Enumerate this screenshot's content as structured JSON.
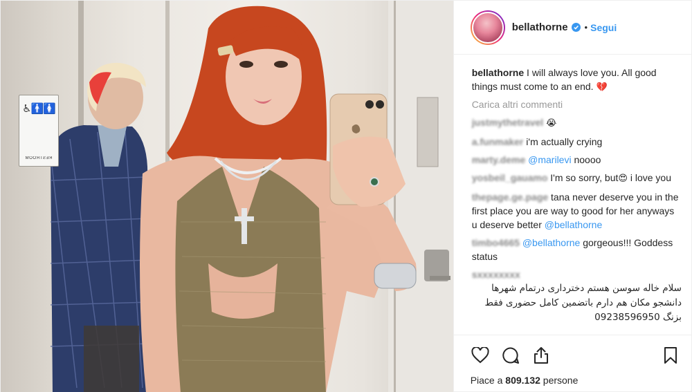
{
  "post": {
    "header": {
      "username": "bellathorne",
      "separator": "•",
      "follow_label": "Segui",
      "avatar_icon": "profile-avatar",
      "verified_icon": "verified-badge-icon"
    },
    "caption": {
      "username": "bellathorne",
      "text": "I will always love you. All good things must come to an end.",
      "emoji": "💔"
    },
    "load_more_label": "Carica altri commenti",
    "comments": [
      {
        "user": "justmythetravel",
        "text": "",
        "emoji": "😭"
      },
      {
        "user": "a.funmaker",
        "text": "i'm actually crying",
        "emoji": ""
      },
      {
        "user": "marty.deme",
        "mention": "@marilevi",
        "text": " noooo",
        "emoji": ""
      },
      {
        "user": "yosbeil_gauamo",
        "text": "I'm so sorry, but",
        "emoji": "😍",
        "text2": " i love you"
      },
      {
        "user": "thepage.ge.page",
        "text": "tana never deserve you in the first place you are way to good for her anyways u deserve better",
        "mention_after": "@bellathorne"
      },
      {
        "user": "timbo4665",
        "mention": "@bellathorne",
        "text": " gorgeous!!! Goddess status"
      },
      {
        "user": "sxxxxxxxx",
        "text": "سلام خاله سوسن هستم دخترداری درتمام شهرها دانشجو مکان هم دارم باتضمین کامل حضوری فقط بزنگ 09238596950"
      }
    ],
    "likes": {
      "prefix": "Piace a",
      "count": "809.132",
      "suffix": "persone"
    },
    "actions": {
      "like_icon": "heart-icon",
      "comment_icon": "comment-bubble-icon",
      "share_icon": "share-icon",
      "save_icon": "bookmark-icon"
    },
    "photo": {
      "restroom_sign_glyphs": "♿🚹🚺",
      "restroom_sign_word": "RESTROOM"
    }
  },
  "colors": {
    "accent": "#3897f0",
    "text": "#262626",
    "muted": "#999999",
    "heart_emoji": "#d8243c"
  }
}
